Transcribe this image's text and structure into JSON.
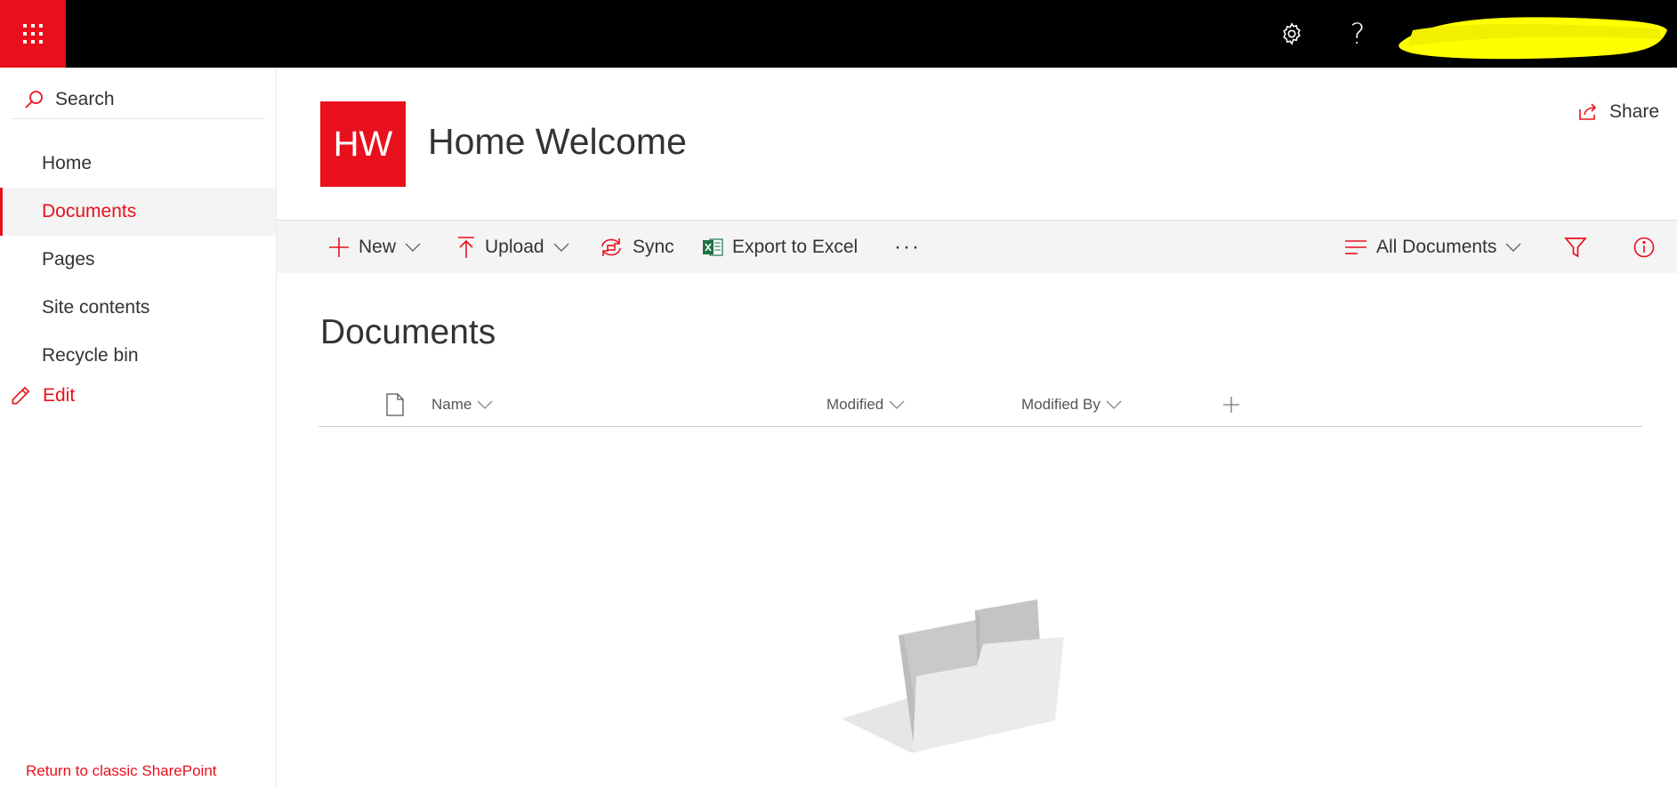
{
  "suitebar": {
    "app_launcher_icon": "waffle-grid-icon",
    "settings_icon": "gear-icon",
    "help_label": "?",
    "help_icon": "question-mark-icon",
    "redaction_color": "#ffff00"
  },
  "nav": {
    "search_label": "Search",
    "items": [
      {
        "label": "Home",
        "active": false
      },
      {
        "label": "Documents",
        "active": true
      },
      {
        "label": "Pages",
        "active": false
      },
      {
        "label": "Site contents",
        "active": false
      },
      {
        "label": "Recycle bin",
        "active": false
      }
    ],
    "edit_label": "Edit",
    "classic_link": "Return to classic SharePoint"
  },
  "site": {
    "logo_initials": "HW",
    "title": "Home Welcome",
    "share_label": "Share"
  },
  "commands": {
    "new_label": "New",
    "upload_label": "Upload",
    "sync_label": "Sync",
    "export_label": "Export to Excel",
    "more_label": "···",
    "view_label": "All Documents"
  },
  "library": {
    "title": "Documents",
    "columns": {
      "name": "Name",
      "modified": "Modified",
      "modified_by": "Modified By"
    }
  },
  "colors": {
    "accent": "#e8101d",
    "suitebar": "#000000",
    "excel_green": "#1e7145",
    "commandbar_bg": "#f4f4f4"
  }
}
